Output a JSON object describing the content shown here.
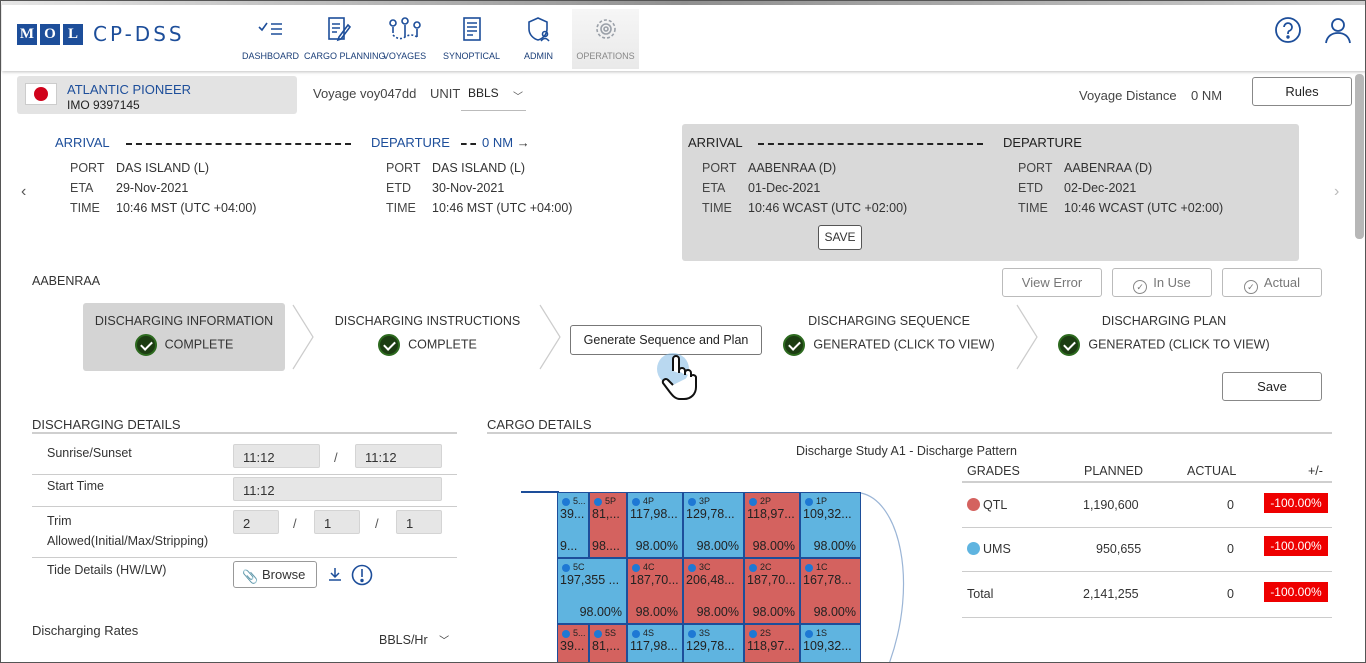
{
  "brand": {
    "logo_letters": [
      "M",
      "O",
      "L"
    ],
    "app_name": "CP-DSS"
  },
  "nav": [
    {
      "label": "DASHBOARD",
      "icon": "checklist-icon"
    },
    {
      "label": "CARGO PLANNING",
      "icon": "edit-document-icon"
    },
    {
      "label": "VOYAGES",
      "icon": "route-icon"
    },
    {
      "label": "SYNOPTICAL",
      "icon": "report-icon"
    },
    {
      "label": "ADMIN",
      "icon": "shield-user-icon"
    },
    {
      "label": "OPERATIONS",
      "icon": "gear-icon",
      "active": true
    }
  ],
  "vessel": {
    "name": "ATLANTIC PIONEER",
    "imo": "IMO 9397145",
    "voyage": "Voyage voy047dd",
    "unit_label": "UNIT",
    "unit_value": "BBLS"
  },
  "voyage_distance": {
    "label": "Voyage Distance",
    "value": "0 NM"
  },
  "rules_label": "Rules",
  "port1": {
    "arrival_label": "ARRIVAL",
    "departure_label": "DEPARTURE",
    "distance": "0 NM",
    "arrival": {
      "port_k": "PORT",
      "port": "DAS ISLAND (L)",
      "eta_k": "ETA",
      "eta": "29-Nov-2021",
      "time_k": "TIME",
      "time": "10:46 MST (UTC +04:00)"
    },
    "departure": {
      "port_k": "PORT",
      "port": "DAS ISLAND (L)",
      "etd_k": "ETD",
      "etd": "30-Nov-2021",
      "time_k": "TIME",
      "time": "10:46 MST (UTC +04:00)"
    }
  },
  "port2": {
    "arrival_label": "ARRIVAL",
    "departure_label": "DEPARTURE",
    "save_label": "SAVE",
    "arrival": {
      "port_k": "PORT",
      "port": "AABENRAA (D)",
      "eta_k": "ETA",
      "eta": "01-Dec-2021",
      "time_k": "TIME",
      "time": "10:46 WCAST (UTC +02:00)"
    },
    "departure": {
      "port_k": "PORT",
      "port": "AABENRAA (D)",
      "etd_k": "ETD",
      "etd": "02-Dec-2021",
      "time_k": "TIME",
      "time": "10:46 WCAST (UTC +02:00)"
    }
  },
  "port_name": "AABENRAA",
  "actions": {
    "view_error": "View Error",
    "in_use": "In Use",
    "actual": "Actual",
    "save": "Save",
    "generate": "Generate Sequence and Plan"
  },
  "steps": [
    {
      "title": "DISCHARGING INFORMATION",
      "status": "COMPLETE"
    },
    {
      "title": "DISCHARGING INSTRUCTIONS",
      "status": "COMPLETE"
    },
    {
      "title": "DISCHARGING SEQUENCE",
      "status": "GENERATED (CLICK TO VIEW)"
    },
    {
      "title": "DISCHARGING PLAN",
      "status": "GENERATED (CLICK TO VIEW)"
    }
  ],
  "discharging_details": {
    "heading": "DISCHARGING DETAILS",
    "sunrise_label": "Sunrise/Sunset",
    "sunrise": "11:12",
    "sunset": "11:12",
    "start_label": "Start Time",
    "start": "11:12",
    "trim_label": "Trim Allowed(Initial/Max/Stripping)",
    "trim_initial": "2",
    "trim_max": "1",
    "trim_stripping": "1",
    "tide_label": "Tide Details (HW/LW)",
    "browse_label": "Browse",
    "rates_label": "Discharging Rates",
    "rates_unit": "BBLS/Hr"
  },
  "cargo": {
    "heading": "CARGO DETAILS",
    "chart_title": "Discharge Study A1 - Discharge Pattern",
    "tanks_row1": [
      {
        "name": "5...",
        "vol": "39...",
        "pct": "9...",
        "color": "blue"
      },
      {
        "name": "5P",
        "vol": "81,...",
        "pct": "98....",
        "color": "red"
      },
      {
        "name": "4P",
        "vol": "117,98...",
        "pct": "98.00%",
        "color": "blue"
      },
      {
        "name": "3P",
        "vol": "129,78...",
        "pct": "98.00%",
        "color": "blue"
      },
      {
        "name": "2P",
        "vol": "118,97...",
        "pct": "98.00%",
        "color": "red"
      },
      {
        "name": "1P",
        "vol": "109,32...",
        "pct": "98.00%",
        "color": "blue"
      }
    ],
    "tanks_row2": [
      {
        "name": "5C",
        "vol": "197,355 ...",
        "pct": "98.00%",
        "color": "blue"
      },
      {
        "name": "4C",
        "vol": "187,70...",
        "pct": "98.00%",
        "color": "red"
      },
      {
        "name": "3C",
        "vol": "206,48...",
        "pct": "98.00%",
        "color": "red"
      },
      {
        "name": "2C",
        "vol": "187,70...",
        "pct": "98.00%",
        "color": "red"
      },
      {
        "name": "1C",
        "vol": "167,78...",
        "pct": "98.00%",
        "color": "red"
      }
    ],
    "tanks_row3": [
      {
        "name": "5...",
        "vol": "39...",
        "color": "red"
      },
      {
        "name": "5S",
        "vol": "81,...",
        "color": "red"
      },
      {
        "name": "4S",
        "vol": "117,98...",
        "color": "blue"
      },
      {
        "name": "3S",
        "vol": "129,78...",
        "color": "blue"
      },
      {
        "name": "2S",
        "vol": "118,97...",
        "color": "red"
      },
      {
        "name": "1S",
        "vol": "109,32...",
        "color": "blue"
      }
    ],
    "colors": {
      "blue": "#5fb4e0",
      "red": "#d4625f",
      "neg": "#ee0000"
    },
    "grades_header": {
      "grades": "GRADES",
      "planned": "PLANNED",
      "actual": "ACTUAL",
      "diff": "+/-"
    },
    "grades": [
      {
        "name": "QTL",
        "planned": "1,190,600",
        "actual": "0",
        "diff": "-100.00%",
        "color": "#d4625f"
      },
      {
        "name": "UMS",
        "planned": "950,655",
        "actual": "0",
        "diff": "-100.00%",
        "color": "#5fb4e0"
      }
    ],
    "total": {
      "name": "Total",
      "planned": "2,141,255",
      "actual": "0",
      "diff": "-100.00%"
    }
  }
}
